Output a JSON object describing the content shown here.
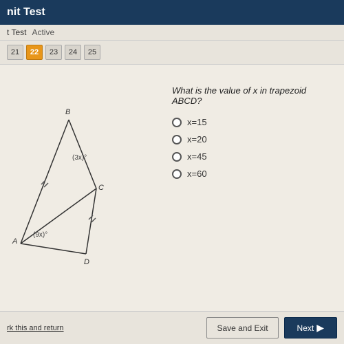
{
  "header": {
    "title": "nit Test",
    "sub_title": "t Test",
    "status": "Active"
  },
  "nav": {
    "tabs": [
      {
        "label": "21",
        "state": "normal"
      },
      {
        "label": "22",
        "state": "active"
      },
      {
        "label": "23",
        "state": "normal"
      },
      {
        "label": "24",
        "state": "normal"
      },
      {
        "label": "25",
        "state": "normal"
      }
    ]
  },
  "question": {
    "text": "What is the value of x in trapezoid ABCD?",
    "options": [
      {
        "label": "x=15"
      },
      {
        "label": "x=20"
      },
      {
        "label": "x=45"
      },
      {
        "label": "x=60"
      }
    ]
  },
  "diagram": {
    "vertices": {
      "A": "point A (bottom-left)",
      "B": "point B (top)",
      "C": "point C (middle-right)",
      "D": "point D (bottom-right)"
    },
    "angle_labels": [
      {
        "label": "(3x)°",
        "position": "near B-C"
      },
      {
        "label": "(9x)°",
        "position": "near A-D"
      }
    ]
  },
  "bottom": {
    "mark_return": "rk this and return",
    "save_button": "Save and Exit",
    "next_button": "Next"
  }
}
